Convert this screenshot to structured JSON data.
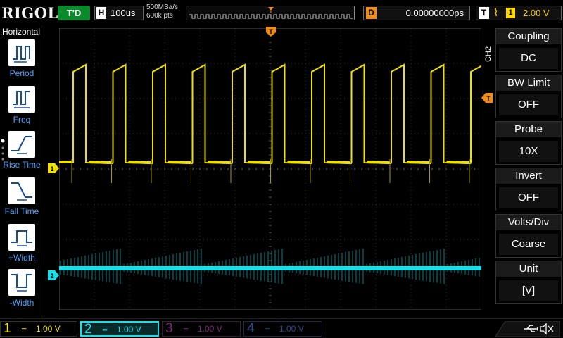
{
  "brand": "RIGOL",
  "run_status": "T'D",
  "horizontal": {
    "tag": "H",
    "timebase": "100us",
    "sample_rate": "500MSa/s",
    "memory_depth": "600k pts"
  },
  "delay": {
    "tag": "D",
    "value": "0.00000000ps"
  },
  "trigger": {
    "tag": "T",
    "source": "1",
    "level": "2.00 V"
  },
  "left_menu": {
    "title": "Horizontal",
    "items": [
      {
        "label": "Period",
        "icon": "period-icon"
      },
      {
        "label": "Freq",
        "icon": "freq-icon"
      },
      {
        "label": "Rise Time",
        "icon": "rise-time-icon"
      },
      {
        "label": "Fall Time",
        "icon": "fall-time-icon"
      },
      {
        "label": "+Width",
        "icon": "positive-width-icon"
      },
      {
        "label": "-Width",
        "icon": "negative-width-icon"
      }
    ]
  },
  "right_menu": {
    "channel_tab": "CH2",
    "items": [
      {
        "title": "Coupling",
        "value": "DC"
      },
      {
        "title": "BW Limit",
        "value": "OFF"
      },
      {
        "title": "Probe",
        "value": "10X"
      },
      {
        "title": "Invert",
        "value": "OFF"
      },
      {
        "title": "Volts/Div",
        "value": "Coarse"
      },
      {
        "title": "Unit",
        "value": "[V]"
      }
    ]
  },
  "markers": {
    "ch1": "1",
    "ch2": "2",
    "trigger_pos": "T"
  },
  "channels": [
    {
      "num": "1",
      "scale": "1.00 V",
      "color": "#f0e000"
    },
    {
      "num": "2",
      "scale": "1.00 V",
      "color": "#00e5e5"
    },
    {
      "num": "3",
      "scale": "1.00 V",
      "color": "#7a2a7a"
    },
    {
      "num": "4",
      "scale": "1.00 V",
      "color": "#2a4a8a"
    }
  ],
  "colors": {
    "ch1": "#f0e000",
    "ch2": "#19e0e8",
    "trigger": "#f08c1a",
    "menu_accent": "#4da6ff"
  }
}
